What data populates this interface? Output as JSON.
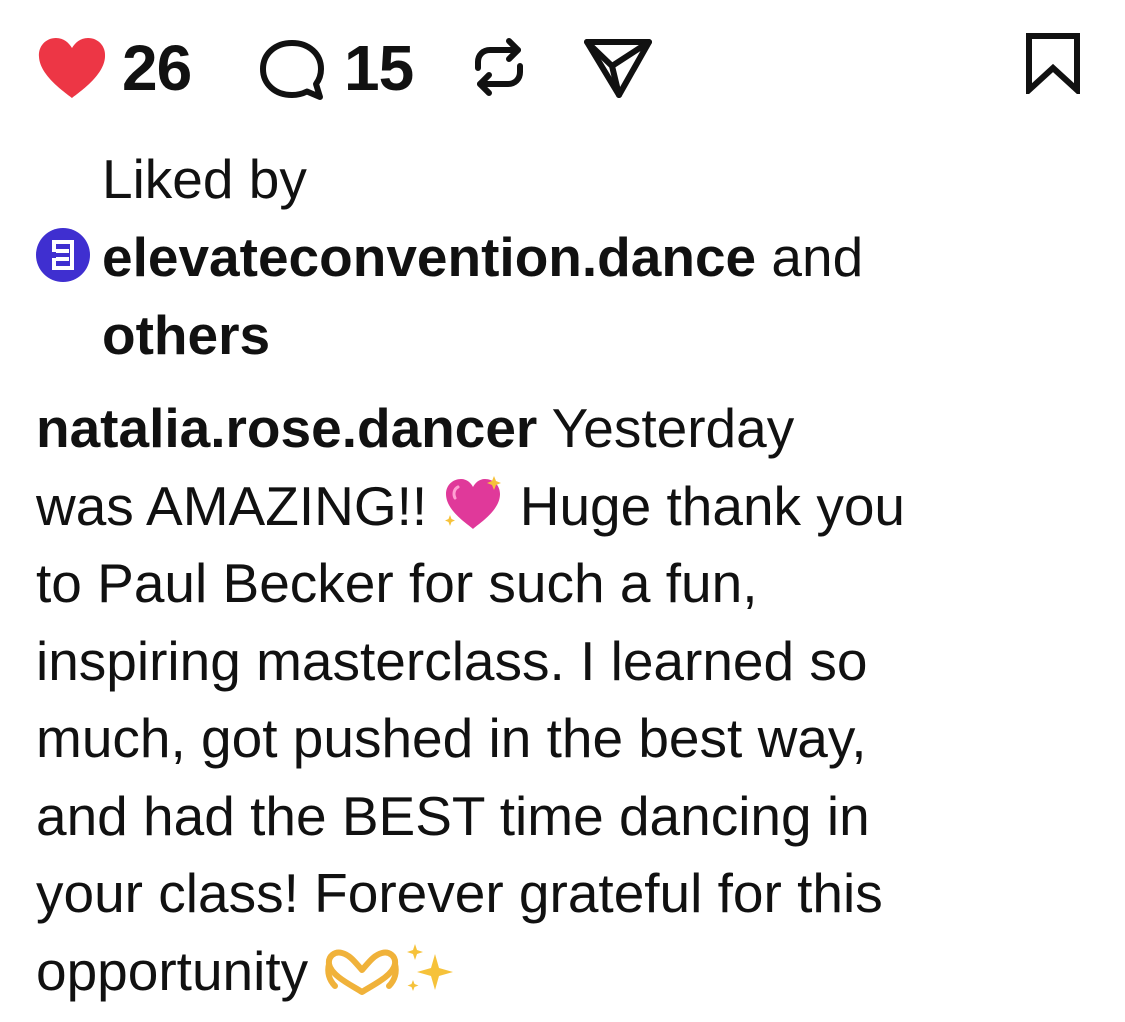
{
  "actions": {
    "like_count": "26",
    "comment_count": "15",
    "like_color": "#ed3645",
    "icons": [
      "heart-icon",
      "comment-icon",
      "repost-icon",
      "share-icon",
      "bookmark-icon"
    ]
  },
  "liked_by": {
    "prefix": "Liked by",
    "account": "elevateconvention.dance",
    "conjunction": "and",
    "others": "others",
    "avatar_color": "#3f2fd0"
  },
  "caption": {
    "username": "natalia.rose.dancer",
    "lines": [
      " Yesterday",
      "was AMAZING!! ",
      " Huge thank you",
      "to Paul Becker for such a fun,",
      "inspiring masterclass. I learned so",
      "much, got pushed in the best way,",
      "and had the BEST time dancing in",
      "your class! Forever grateful for this",
      "opportunity "
    ]
  }
}
